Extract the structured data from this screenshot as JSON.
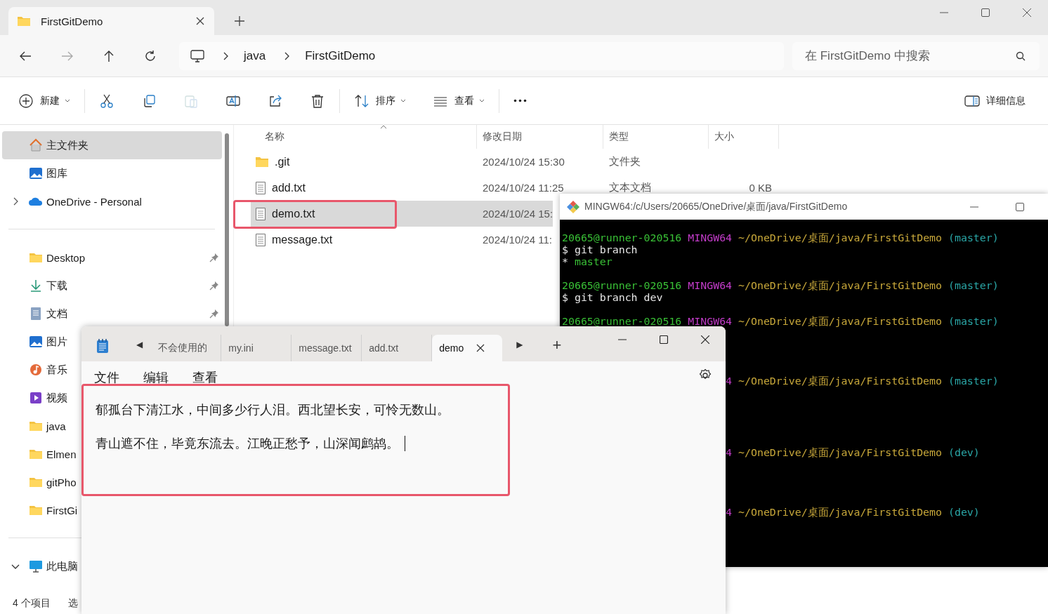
{
  "explorer": {
    "tabs": [
      {
        "label": "FirstGitDemo",
        "selected": true
      }
    ],
    "breadcrumb": [
      "java",
      "FirstGitDemo"
    ],
    "search": {
      "placeholder": "在 FirstGitDemo 中搜索"
    },
    "toolbar": [
      {
        "kind": "new",
        "label": "新建",
        "disabled": false
      },
      {
        "kind": "cut",
        "disabled": false
      },
      {
        "kind": "copy",
        "disabled": false
      },
      {
        "kind": "paste",
        "disabled": true
      },
      {
        "kind": "rename",
        "disabled": false
      },
      {
        "kind": "share",
        "disabled": false
      },
      {
        "kind": "delete",
        "disabled": false
      },
      {
        "kind": "sort",
        "label": "排序",
        "disabled": false
      },
      {
        "kind": "view",
        "label": "查看",
        "disabled": false
      },
      {
        "kind": "more",
        "disabled": false
      }
    ],
    "details": {
      "label": "详细信息"
    },
    "sidebar": {
      "groups": [
        [
          {
            "kind": "home",
            "label": "主文件夹",
            "selected": true,
            "pinned": false
          },
          {
            "kind": "gallery",
            "label": "图库",
            "selected": false,
            "pinned": false
          },
          {
            "kind": "cloud",
            "label": "OneDrive - Personal",
            "selected": false,
            "pinned": false,
            "expanded": false
          }
        ],
        [
          {
            "kind": "folder",
            "label": "Desktop",
            "selected": false,
            "pinned": true
          },
          {
            "kind": "download",
            "label": "下载",
            "selected": false,
            "pinned": true
          },
          {
            "kind": "docs",
            "label": "文档",
            "selected": false,
            "pinned": true
          },
          {
            "kind": "pictures",
            "label": "图片",
            "selected": false,
            "pinned": false
          },
          {
            "kind": "music",
            "label": "音乐",
            "selected": false,
            "pinned": false
          },
          {
            "kind": "video",
            "label": "视频",
            "selected": false,
            "pinned": false
          },
          {
            "kind": "folder",
            "label": "java",
            "selected": false,
            "pinned": false
          },
          {
            "kind": "folder",
            "label": "Elmen",
            "selected": false,
            "pinned": false
          },
          {
            "kind": "folder",
            "label": "gitPho",
            "selected": false,
            "pinned": false
          },
          {
            "kind": "folder",
            "label": "FirstGi",
            "selected": false,
            "pinned": false
          }
        ],
        [
          {
            "kind": "pc",
            "label": "此电脑",
            "selected": false,
            "pinned": false,
            "expanded": true
          }
        ]
      ]
    },
    "columns": [
      "名称",
      "修改日期",
      "类型",
      "大小"
    ],
    "rows": [
      {
        "kind": "folder",
        "name": ".git",
        "date": "2024/10/24 15:30",
        "type": "文件夹",
        "size": "",
        "selected": false
      },
      {
        "kind": "file",
        "name": "add.txt",
        "date": "2024/10/24 11:25",
        "type": "文本文档",
        "size": "0 KB",
        "selected": false
      },
      {
        "kind": "file",
        "name": "demo.txt",
        "date": "2024/10/24 15:",
        "type": "",
        "size": "",
        "selected": true
      },
      {
        "kind": "file",
        "name": "message.txt",
        "date": "2024/10/24 11:",
        "type": "",
        "size": "",
        "selected": false
      }
    ],
    "status": [
      "4 个项目",
      "选"
    ]
  },
  "terminal": {
    "title": "MINGW64:/c/Users/20665/OneDrive/桌面/java/FirstGitDemo",
    "lines": [
      {
        "partial": false,
        "segments": [
          {
            "kind": "user",
            "text": "20665@runner-020516"
          },
          {
            "kind": "shell",
            "text": "MINGW64"
          },
          {
            "kind": "path",
            "text": "~/OneDrive/桌面/java/FirstGitDemo"
          },
          {
            "kind": "branch",
            "text": "(master)"
          }
        ]
      },
      {
        "partial": false,
        "segments": [
          {
            "kind": "cmd",
            "text": "$ git branch"
          }
        ]
      },
      {
        "partial": false,
        "segments": [
          {
            "kind": "cmd",
            "text": "*"
          },
          {
            "kind": "out",
            "text": "master"
          }
        ]
      },
      {
        "partial": false,
        "segments": [
          {
            "kind": "user",
            "text": "20665@runner-020516"
          },
          {
            "kind": "shell",
            "text": "MINGW64"
          },
          {
            "kind": "path",
            "text": "~/OneDrive/桌面/java/FirstGitDemo"
          },
          {
            "kind": "branch",
            "text": "(master)"
          }
        ]
      },
      {
        "partial": false,
        "segments": [
          {
            "kind": "cmd",
            "text": "$ git branch dev"
          }
        ]
      },
      {
        "partial": false,
        "segments": [
          {
            "kind": "user",
            "text": "20665@runner-020516"
          },
          {
            "kind": "shell",
            "text": "MINGW64"
          },
          {
            "kind": "path",
            "text": "~/OneDrive/桌面/java/FirstGitDemo"
          },
          {
            "kind": "branch",
            "text": "(master)"
          }
        ]
      },
      {
        "partial": true,
        "segments": [
          {
            "kind": "shell",
            "text": "4"
          },
          {
            "kind": "path",
            "text": "~/OneDrive/桌面/java/FirstGitDemo"
          },
          {
            "kind": "branch",
            "text": "(master)"
          }
        ]
      },
      {
        "partial": true,
        "segments": [
          {
            "kind": "shell",
            "text": "4"
          },
          {
            "kind": "path",
            "text": "~/OneDrive/桌面/java/FirstGitDemo"
          },
          {
            "kind": "branch",
            "text": "(dev)"
          }
        ]
      },
      {
        "partial": true,
        "segments": [
          {
            "kind": "shell",
            "text": "4"
          },
          {
            "kind": "path",
            "text": "~/OneDrive/桌面/java/FirstGitDemo"
          },
          {
            "kind": "branch",
            "text": "(dev)"
          }
        ]
      }
    ]
  },
  "notepad": {
    "tabs": [
      {
        "label": "不会使用的",
        "selected": false
      },
      {
        "label": "my.ini",
        "selected": false
      },
      {
        "label": "message.txt",
        "selected": false
      },
      {
        "label": "add.txt",
        "selected": false
      },
      {
        "label": "demo",
        "selected": true
      }
    ],
    "scroll_left": "◀",
    "scroll_right": "▶",
    "new_tab": "+",
    "menu": [
      "文件",
      "编辑",
      "查看"
    ],
    "lines": [
      "郁孤台下清江水，中间多少行人泪。西北望长安，可怜无数山。",
      "青山遮不住，毕竟东流去。江晚正愁予，山深闻鹧鸪。"
    ]
  }
}
